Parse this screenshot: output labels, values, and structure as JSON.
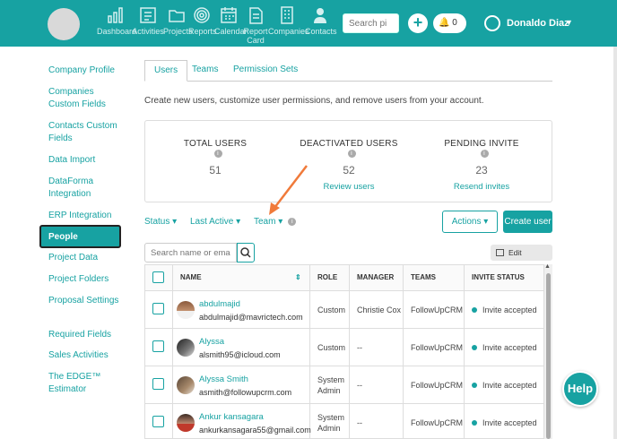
{
  "header": {
    "nav": [
      {
        "label": "Dashboard",
        "icon": "bar-chart-icon"
      },
      {
        "label": "Activities",
        "icon": "checklist-icon"
      },
      {
        "label": "Projects",
        "icon": "folder-icon"
      },
      {
        "label": "Reports",
        "icon": "target-icon"
      },
      {
        "label": "Calendar",
        "icon": "calendar-icon"
      },
      {
        "label": "Report Card",
        "icon": "report-card-icon"
      },
      {
        "label": "Companies",
        "icon": "building-icon"
      },
      {
        "label": "Contacts",
        "icon": "contacts-icon"
      }
    ],
    "search_placeholder": "Search pi",
    "plus": "+",
    "notifications": "0",
    "user_name": "Donaldo Diaz"
  },
  "sidebar": {
    "items": [
      {
        "label": "Company Profile"
      },
      {
        "label": "Companies Custom Fields"
      },
      {
        "label": "Contacts Custom Fields"
      },
      {
        "label": "Data Import"
      },
      {
        "label": "DataForma Integration"
      },
      {
        "label": "ERP Integration"
      },
      {
        "label": "People"
      },
      {
        "label": "Project Data"
      },
      {
        "label": "Project Folders"
      },
      {
        "label": "Proposal Settings"
      },
      {
        "label": "Required Fields"
      },
      {
        "label": "Sales Activities"
      },
      {
        "label": "The EDGE™ Estimator"
      }
    ]
  },
  "tabs": [
    {
      "label": "Users"
    },
    {
      "label": "Teams"
    },
    {
      "label": "Permission Sets"
    }
  ],
  "description": "Create new users, customize user permissions, and remove users from your account.",
  "stats": {
    "total": {
      "label": "TOTAL USERS",
      "value": "51"
    },
    "deactivated": {
      "label": "DEACTIVATED USERS",
      "value": "52",
      "link": "Review users"
    },
    "pending": {
      "label": "PENDING INVITE",
      "value": "23",
      "link": "Resend invites"
    }
  },
  "filters": {
    "status": "Status",
    "last_active": "Last Active",
    "team": "Team",
    "actions": "Actions",
    "create_user": "Create user"
  },
  "table": {
    "search_placeholder": "Search name or email a",
    "edit_columns": "Edit Columns",
    "columns": {
      "name": "NAME",
      "role": "ROLE",
      "manager": "MANAGER",
      "teams": "TEAMS",
      "invite_status": "INVITE STATUS"
    },
    "rows": [
      {
        "name": "abdulmajid",
        "email": "abdulmajid@mavrictech.com",
        "role": "Custom",
        "manager": "Christie Cox",
        "team": "FollowUpCRM",
        "status": "Invite accepted"
      },
      {
        "name": "Alyssa",
        "email": "alsmith95@icloud.com",
        "role": "Custom",
        "manager": "--",
        "team": "FollowUpCRM",
        "status": "Invite accepted"
      },
      {
        "name": "Alyssa Smith",
        "email": "asmith@followupcrm.com",
        "role": "System Admin",
        "manager": "--",
        "team": "FollowUpCRM",
        "status": "Invite accepted"
      },
      {
        "name": "Ankur kansagara",
        "email": "ankurkansagara55@gmail.com",
        "role": "System Admin",
        "manager": "--",
        "team": "FollowUpCRM",
        "status": "Invite accepted"
      }
    ]
  },
  "help_label": "Help",
  "colors": {
    "accent": "#17a2a2"
  }
}
